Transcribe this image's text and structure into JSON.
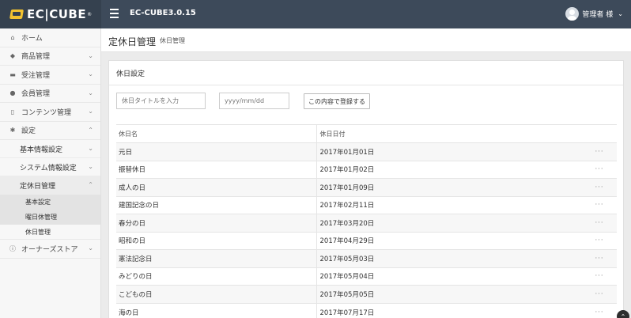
{
  "header": {
    "logo_text": "EC|CUBE",
    "logo_reg": "®",
    "app_title": "EC-CUBE3.0.15",
    "user_name": "管理者 様",
    "user_caret": "⌄"
  },
  "sidebar": {
    "items": [
      {
        "label": "ホーム",
        "icon": "home-icon"
      },
      {
        "label": "商品管理",
        "icon": "tag-icon"
      },
      {
        "label": "受注管理",
        "icon": "cart-icon"
      },
      {
        "label": "会員管理",
        "icon": "users-icon"
      },
      {
        "label": "コンテンツ管理",
        "icon": "file-icon"
      },
      {
        "label": "設定",
        "icon": "gear-icon"
      }
    ],
    "settings_sub": [
      {
        "label": "基本情報設定"
      },
      {
        "label": "システム情報設定"
      },
      {
        "label": "定休日管理"
      }
    ],
    "holiday_sub": [
      {
        "label": "基本設定"
      },
      {
        "label": "曜日休管理"
      },
      {
        "label": "休日管理"
      }
    ],
    "owners_store": {
      "label": "オーナーズストア",
      "icon": "info-icon"
    }
  },
  "page": {
    "title": "定休日管理",
    "subtitle": "休日管理"
  },
  "card": {
    "title": "休日設定",
    "name_placeholder": "休日タイトルを入力",
    "date_placeholder": "yyyy/mm/dd",
    "add_button": "この内容で登録する"
  },
  "table": {
    "headers": [
      "休日名",
      "休日日付",
      ""
    ],
    "rows": [
      {
        "name": "元日",
        "date": "2017年01月01日",
        "menu": "···"
      },
      {
        "name": "振替休日",
        "date": "2017年01月02日",
        "menu": "···"
      },
      {
        "name": "成人の日",
        "date": "2017年01月09日",
        "menu": "···"
      },
      {
        "name": "建国記念の日",
        "date": "2017年02月11日",
        "menu": "···"
      },
      {
        "name": "春分の日",
        "date": "2017年03月20日",
        "menu": "···"
      },
      {
        "name": "昭和の日",
        "date": "2017年04月29日",
        "menu": "···"
      },
      {
        "name": "憲法記念日",
        "date": "2017年05月03日",
        "menu": "···"
      },
      {
        "name": "みどりの日",
        "date": "2017年05月04日",
        "menu": "···"
      },
      {
        "name": "こどもの日",
        "date": "2017年05月05日",
        "menu": "···"
      },
      {
        "name": "海の日",
        "date": "2017年07月17日",
        "menu": "···"
      }
    ]
  },
  "scroll_top_icon": "chevron-up-icon"
}
